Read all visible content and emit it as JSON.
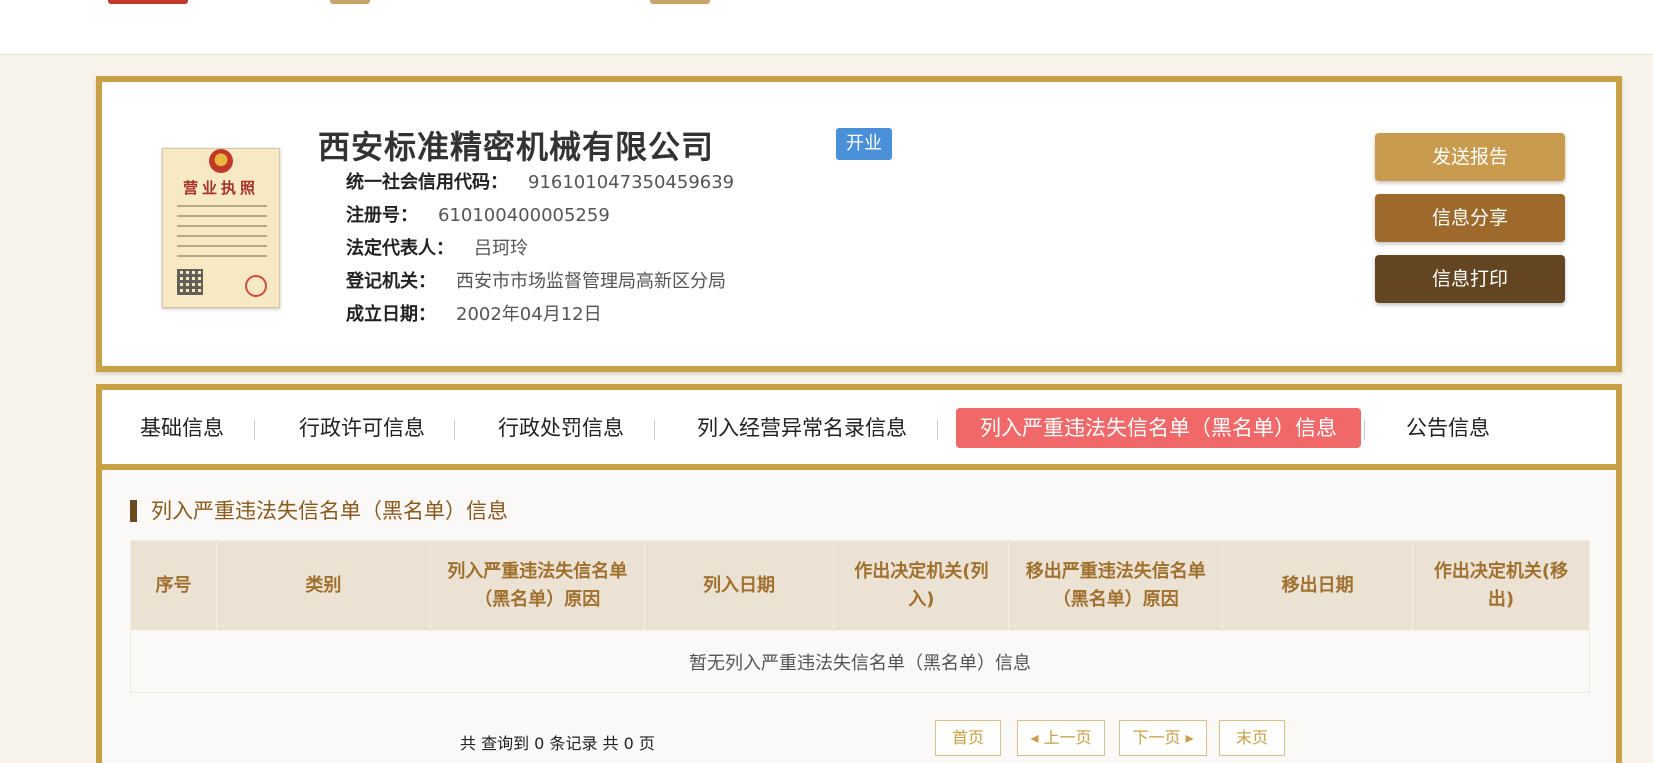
{
  "company": {
    "name": "西安标准精密机械有限公司",
    "status": "开业",
    "license_title": "营业执照",
    "fields": [
      {
        "label": "统一社会信用代码：",
        "value": "916101047350459639"
      },
      {
        "label": "注册号：",
        "value": "610100400005259"
      },
      {
        "label": "法定代表人：",
        "value": "吕珂玲"
      },
      {
        "label": "登记机关：",
        "value": "西安市市场监督管理局高新区分局"
      },
      {
        "label": "成立日期：",
        "value": "2002年04月12日"
      }
    ]
  },
  "actions": {
    "send": "发送报告",
    "share": "信息分享",
    "print": "信息打印"
  },
  "tabs": [
    {
      "label": "基础信息"
    },
    {
      "label": "行政许可信息"
    },
    {
      "label": "行政处罚信息"
    },
    {
      "label": "列入经营异常名录信息"
    },
    {
      "label": "列入严重违法失信名单（黑名单）信息",
      "active": true
    },
    {
      "label": "公告信息"
    }
  ],
  "section": {
    "title": "列入严重违法失信名单（黑名单）信息",
    "columns": [
      "序号",
      "类别",
      "列入严重违法失信名单（黑名单）原因",
      "列入日期",
      "作出决定机关(列入)",
      "移出严重违法失信名单（黑名单）原因",
      "移出日期",
      "作出决定机关(移出)"
    ],
    "empty_text": "暂无列入严重违法失信名单（黑名单）信息"
  },
  "pager": {
    "summary": "共 查询到 0 条记录 共 0 页",
    "first": "首页",
    "prev": "◂ 上一页",
    "next": "下一页 ▸",
    "last": "末页"
  },
  "colors": {
    "gold_border": "#c9a046",
    "active_tab": "#f16869",
    "status_badge": "#4a90d9",
    "btn_send": "#c99b4f",
    "btn_share": "#9e6a2c",
    "btn_print": "#644521"
  }
}
